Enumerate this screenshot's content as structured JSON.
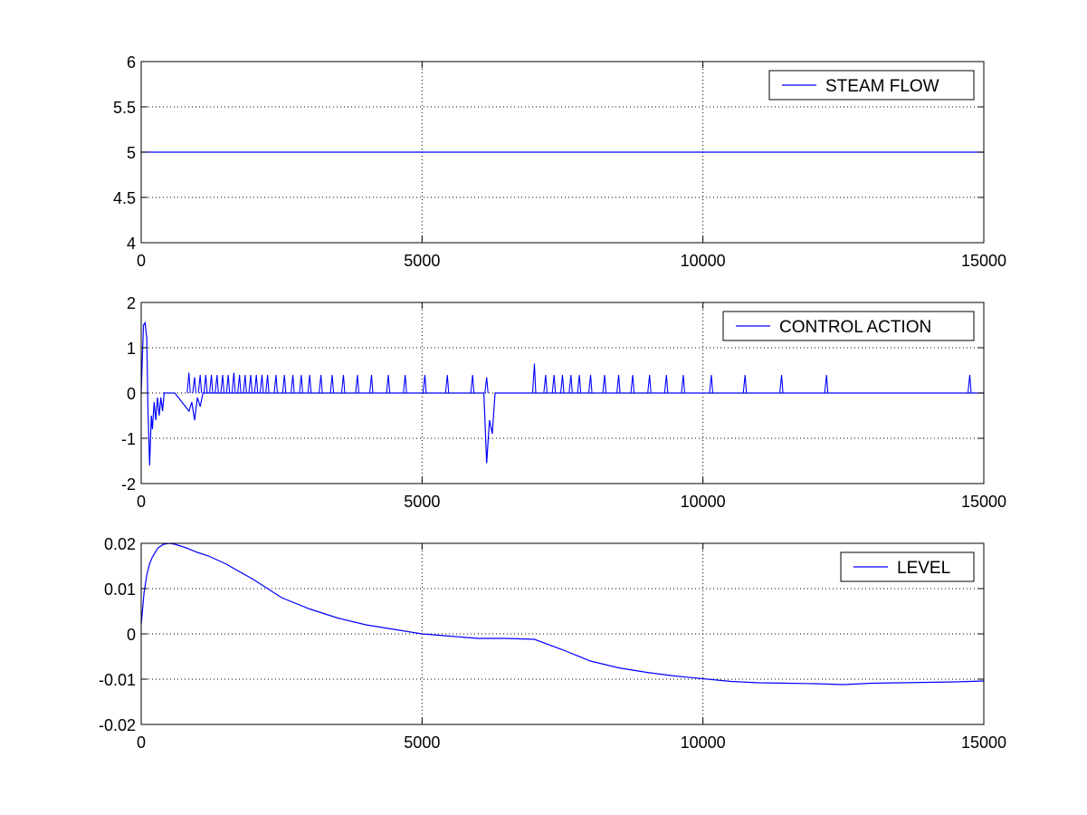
{
  "chart_data": [
    {
      "type": "line",
      "title": "",
      "xlabel": "",
      "ylabel": "",
      "xlim": [
        0,
        15000
      ],
      "ylim": [
        4,
        6
      ],
      "xticks": [
        "0",
        "5000",
        "10000",
        "15000"
      ],
      "yticks": [
        "4",
        "4.5",
        "5",
        "5.5",
        "6"
      ],
      "grid": true,
      "legend_position": "top-right",
      "series_color": "#0000ff",
      "series": [
        {
          "name": "STEAM FLOW",
          "x": [
            0,
            15000
          ],
          "y": [
            5,
            5
          ]
        }
      ]
    },
    {
      "type": "line",
      "title": "",
      "xlabel": "",
      "ylabel": "",
      "xlim": [
        0,
        15000
      ],
      "ylim": [
        -2,
        2
      ],
      "xticks": [
        "0",
        "5000",
        "10000",
        "15000"
      ],
      "yticks": [
        "-2",
        "-1",
        "0",
        "1",
        "2"
      ],
      "grid": true,
      "legend_position": "top-right",
      "series_color": "#0000ff",
      "series": [
        {
          "name": "CONTROL ACTION",
          "x": [
            0,
            40,
            70,
            100,
            120,
            150,
            180,
            200,
            230,
            260,
            290,
            320,
            350,
            380,
            410,
            600,
            850,
            900,
            950,
            1000,
            1050,
            1100,
            6100,
            6150,
            6200,
            6250,
            6300,
            15000
          ],
          "y": [
            0,
            1.5,
            1.55,
            1.2,
            -0.3,
            -1.6,
            -0.5,
            -0.8,
            -0.2,
            -0.6,
            -0.1,
            -0.5,
            -0.1,
            -0.4,
            0,
            0,
            -0.4,
            -0.2,
            -0.6,
            -0.1,
            -0.3,
            0,
            0,
            -1.55,
            -0.6,
            -0.9,
            0,
            0
          ]
        }
      ],
      "spikes": {
        "x": [
          850,
          950,
          1050,
          1150,
          1250,
          1350,
          1450,
          1550,
          1650,
          1750,
          1850,
          1950,
          2050,
          2150,
          2250,
          2400,
          2550,
          2700,
          2850,
          3000,
          3200,
          3400,
          3600,
          3850,
          4100,
          4400,
          4700,
          5050,
          5450,
          5900,
          6150,
          7000,
          7200,
          7350,
          7500,
          7650,
          7800,
          8000,
          8250,
          8500,
          8750,
          9050,
          9350,
          9650,
          10150,
          10750,
          11400,
          12200,
          14750
        ],
        "y": [
          0.45,
          0.35,
          0.4,
          0.4,
          0.4,
          0.4,
          0.4,
          0.4,
          0.45,
          0.4,
          0.4,
          0.4,
          0.4,
          0.4,
          0.4,
          0.4,
          0.4,
          0.4,
          0.4,
          0.4,
          0.4,
          0.4,
          0.4,
          0.4,
          0.4,
          0.4,
          0.4,
          0.4,
          0.4,
          0.4,
          0.35,
          0.65,
          0.4,
          0.4,
          0.4,
          0.4,
          0.4,
          0.4,
          0.4,
          0.4,
          0.4,
          0.4,
          0.4,
          0.4,
          0.4,
          0.4,
          0.4,
          0.4,
          0.4
        ]
      }
    },
    {
      "type": "line",
      "title": "",
      "xlabel": "",
      "ylabel": "",
      "xlim": [
        0,
        15000
      ],
      "ylim": [
        -0.02,
        0.02
      ],
      "xticks": [
        "0",
        "5000",
        "10000",
        "15000"
      ],
      "yticks": [
        "-0.02",
        "-0.01",
        "0",
        "0.01",
        "0.02"
      ],
      "grid": true,
      "legend_position": "top-right",
      "series_color": "#0000ff",
      "series": [
        {
          "name": "LEVEL",
          "x": [
            0,
            50,
            100,
            150,
            200,
            300,
            400,
            500,
            600,
            800,
            1000,
            1200,
            1500,
            2000,
            2500,
            3000,
            3500,
            4000,
            4500,
            5000,
            5500,
            6000,
            6500,
            7000,
            7500,
            8000,
            8500,
            9000,
            9500,
            10000,
            10500,
            11000,
            11500,
            12000,
            12500,
            13000,
            13500,
            14000,
            14500,
            15000
          ],
          "y": [
            0.002,
            0.009,
            0.013,
            0.0155,
            0.017,
            0.019,
            0.0198,
            0.02,
            0.0198,
            0.019,
            0.018,
            0.0172,
            0.0155,
            0.012,
            0.008,
            0.0055,
            0.0035,
            0.002,
            0.001,
            0.0,
            -0.0005,
            -0.001,
            -0.001,
            -0.0012,
            -0.0035,
            -0.006,
            -0.0075,
            -0.0085,
            -0.0093,
            -0.0099,
            -0.0105,
            -0.0108,
            -0.0109,
            -0.011,
            -0.0112,
            -0.0109,
            -0.0108,
            -0.0107,
            -0.0106,
            -0.0104
          ]
        }
      ]
    }
  ]
}
